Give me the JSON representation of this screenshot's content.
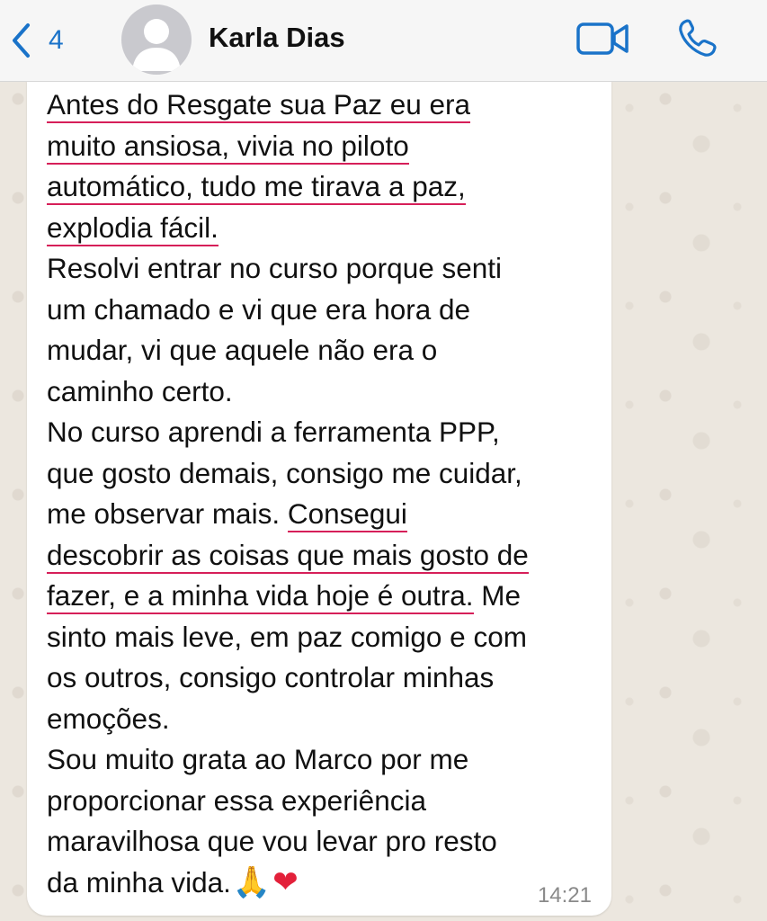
{
  "header": {
    "back_count": "4",
    "contact_name": "Karla Dias",
    "icons": {
      "back": "chevron-left-icon",
      "avatar": "person-silhouette",
      "video": "video-camera-icon",
      "call": "phone-icon"
    },
    "accent_color": "#1a73c9"
  },
  "message": {
    "lines": [
      "Antes do Resgate sua Paz eu era",
      "muito ansiosa, vivia no piloto",
      "automático, tudo me tirava a paz,",
      "explodia fácil.",
      "Resolvi entrar no curso porque senti",
      "um chamado e vi que era hora de",
      "mudar, vi que aquele não era o",
      "caminho certo.",
      "No curso aprendi a ferramenta PPP,",
      "que gosto demais, consigo me cuidar,",
      "me observar mais. ",
      "Consegui",
      "descobrir as coisas que mais gosto de",
      "fazer, e a minha vida hoje é outra.",
      " Me",
      "sinto mais leve, em paz comigo e com",
      "os outros, consigo controlar minhas",
      "emoções.",
      "Sou muito grata ao Marco por me",
      "proporcionar essa experiência",
      "maravilhosa que vou levar pro resto",
      "da minha vida."
    ],
    "emojis": [
      "🙏",
      "❤"
    ],
    "time": "14:21",
    "highlight_color": "#d61f59"
  }
}
